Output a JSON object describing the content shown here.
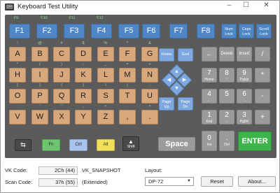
{
  "window": {
    "title": "Keyboard Test Utility",
    "controls": {
      "minimize": "–",
      "maximize": "☐",
      "close": "✕"
    }
  },
  "function_row": {
    "small_labels": [
      "F9",
      "F10",
      "F11",
      "F12"
    ],
    "keys": [
      "F1",
      "F2",
      "F3",
      "F4",
      "F5",
      "F6",
      "F7",
      "F8"
    ],
    "lock_keys": [
      {
        "line1": "Num",
        "line2": "Lock"
      },
      {
        "line1": "Caps",
        "line2": "Lock"
      },
      {
        "line1": "Scroll",
        "line2": "Lock"
      }
    ]
  },
  "alpha_rows": [
    {
      "top_legends": [
        "!",
        "@",
        "#",
        "$",
        "%",
        "^",
        "&"
      ],
      "keys": [
        "A",
        "B",
        "C",
        "D",
        "E",
        "F",
        "G"
      ]
    },
    {
      "top_legends": [
        "*",
        "(",
        ")",
        "-",
        "_",
        "=",
        "+"
      ],
      "keys": [
        "H",
        "I",
        "J",
        "K",
        "L",
        "M",
        "N"
      ]
    },
    {
      "top_legends": [
        "[",
        "]",
        "{",
        "}",
        "\\",
        "|",
        ";"
      ],
      "keys": [
        "O",
        "P",
        "Q",
        "R",
        "S",
        "T",
        "U"
      ]
    },
    {
      "top_legends": [
        ":",
        "'",
        "\"",
        ",",
        "<",
        ".",
        ">"
      ],
      "keys": [
        "V",
        "W",
        "X",
        "Y",
        "Z",
        ",",
        "."
      ]
    }
  ],
  "nav_keys": {
    "home": "Home",
    "end": "End",
    "page_up": {
      "line1": "Page",
      "line2": "Up"
    },
    "page_down": {
      "line1": "Page",
      "line2": "Dn"
    }
  },
  "side_keys": {
    "backspace": "←",
    "delete": "Delete",
    "insert": "Insert",
    "slash": "/",
    "asterisk": "*",
    "minus": "-",
    "plus": "+"
  },
  "numpad": [
    {
      "n": "7",
      "s": "Home"
    },
    {
      "n": "8",
      "s": "↑"
    },
    {
      "n": "9",
      "s": "PgUp"
    },
    {
      "n": "4",
      "s": "←"
    },
    {
      "n": "5",
      "s": ""
    },
    {
      "n": "6",
      "s": "→"
    },
    {
      "n": "1",
      "s": "End"
    },
    {
      "n": "2",
      "s": "↓"
    },
    {
      "n": "3",
      "s": "PgDn"
    },
    {
      "n": "0",
      "s": "Ins"
    },
    {
      "n": ".",
      "s": "Del"
    }
  ],
  "bottom_row": {
    "tab": "⇆",
    "fn": "Fn",
    "ctrl": "Ctrl",
    "alt": "Alt",
    "shift": "Shift",
    "shift_arrow": "▲",
    "space": "Space",
    "enter": "ENTER"
  },
  "status": {
    "vk_code_label": "VK Code:",
    "vk_code_value": "2Ch (44)",
    "vk_name": "VK_SNAPSHOT",
    "scan_code_label": "Scan Code:",
    "scan_code_value": "37h (55)",
    "scan_note": "(Extended)"
  },
  "layout": {
    "label": "Layout:",
    "selected": "DP-72"
  },
  "buttons": {
    "reset": "Reset",
    "about": "About..."
  },
  "colors": {
    "panel": "#5b5b5b",
    "function_key": "#4f86c6",
    "alpha_key": "#d8a77c",
    "nav_key": "#7ea9e0",
    "gray_key": "#9b9b9b",
    "fn_key": "#6fc56f",
    "ctrl_key": "#a8c4ea",
    "alt_key": "#f2e05a",
    "enter_key": "#3db54a",
    "legend": "#8ee08e"
  }
}
